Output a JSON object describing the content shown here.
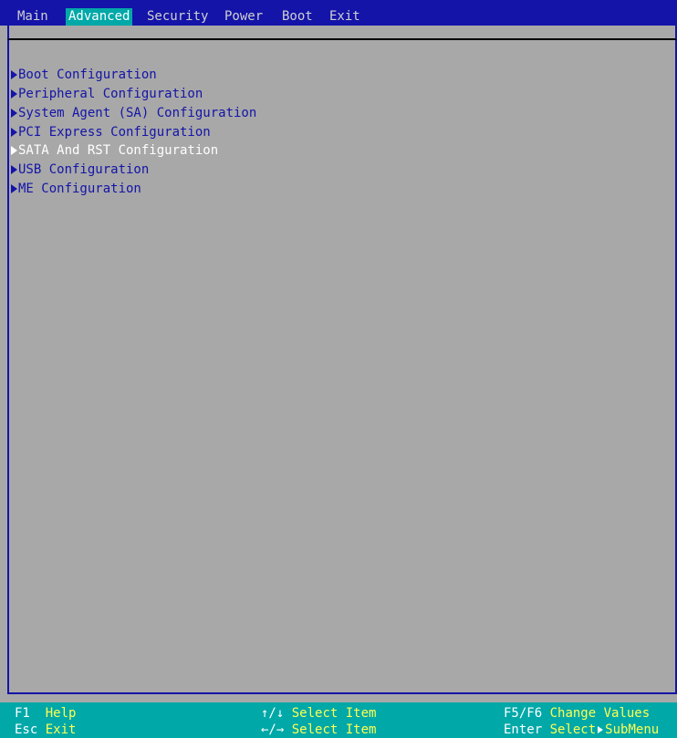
{
  "menu": {
    "tabs": [
      {
        "label": "Main"
      },
      {
        "label": "Advanced"
      },
      {
        "label": "Security"
      },
      {
        "label": "Power"
      },
      {
        "label": "Boot"
      },
      {
        "label": "Exit"
      }
    ],
    "active_tab": "Advanced"
  },
  "items": [
    {
      "label": "Boot Configuration",
      "selected": false
    },
    {
      "label": "Peripheral Configuration",
      "selected": false
    },
    {
      "label": "System Agent (SA) Configuration",
      "selected": false
    },
    {
      "label": "PCI Express Configuration",
      "selected": false
    },
    {
      "label": "SATA And RST Configuration",
      "selected": true
    },
    {
      "label": "USB Configuration",
      "selected": false
    },
    {
      "label": "ME Configuration",
      "selected": false
    }
  ],
  "footer": {
    "f1_key": "F1",
    "f1_desc": "Help",
    "esc_key": "Esc",
    "esc_desc": "Exit",
    "updown_key": "↑/↓",
    "updown_desc": "Select Item",
    "leftright_key": "←/→",
    "leftright_desc": "Select Item",
    "f5f6_key": "F5/F6",
    "f5f6_desc": "Change Values",
    "enter_key": "Enter",
    "enter_desc_1": "Select",
    "enter_desc_2": "SubMenu"
  },
  "colors": {
    "menubar_bg": "#1414a8",
    "active_tab_bg": "#00a8a8",
    "panel_bg": "#a8a8a8",
    "item_text": "#1414a8",
    "selected_item_text": "#ffffff",
    "footer_bg": "#00a8a8",
    "footer_desc": "#ffff54"
  },
  "icons": {
    "submenu_marker": "right-triangle-icon"
  }
}
